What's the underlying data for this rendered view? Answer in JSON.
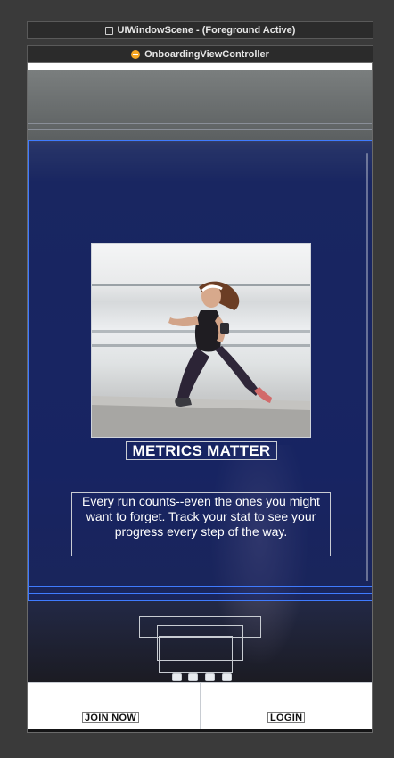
{
  "scene": {
    "title": "UIWindowScene - (Foreground Active)",
    "icon": "window-scene-icon"
  },
  "controller": {
    "title": "OnboardingViewController",
    "icon": "view-controller-icon",
    "icon_color": "#f5a623"
  },
  "onboarding": {
    "headline": "METRICS MATTER",
    "description": "Every run counts--even the ones you might want to forget. Track your stat to see your progress every step of the way.",
    "page_dots": 4,
    "image": "runner-photo"
  },
  "buttons": {
    "join": "JOIN NOW",
    "login": "LOGIN"
  },
  "colors": {
    "selection": "#3f7bff",
    "overlay": "#1c2755"
  }
}
